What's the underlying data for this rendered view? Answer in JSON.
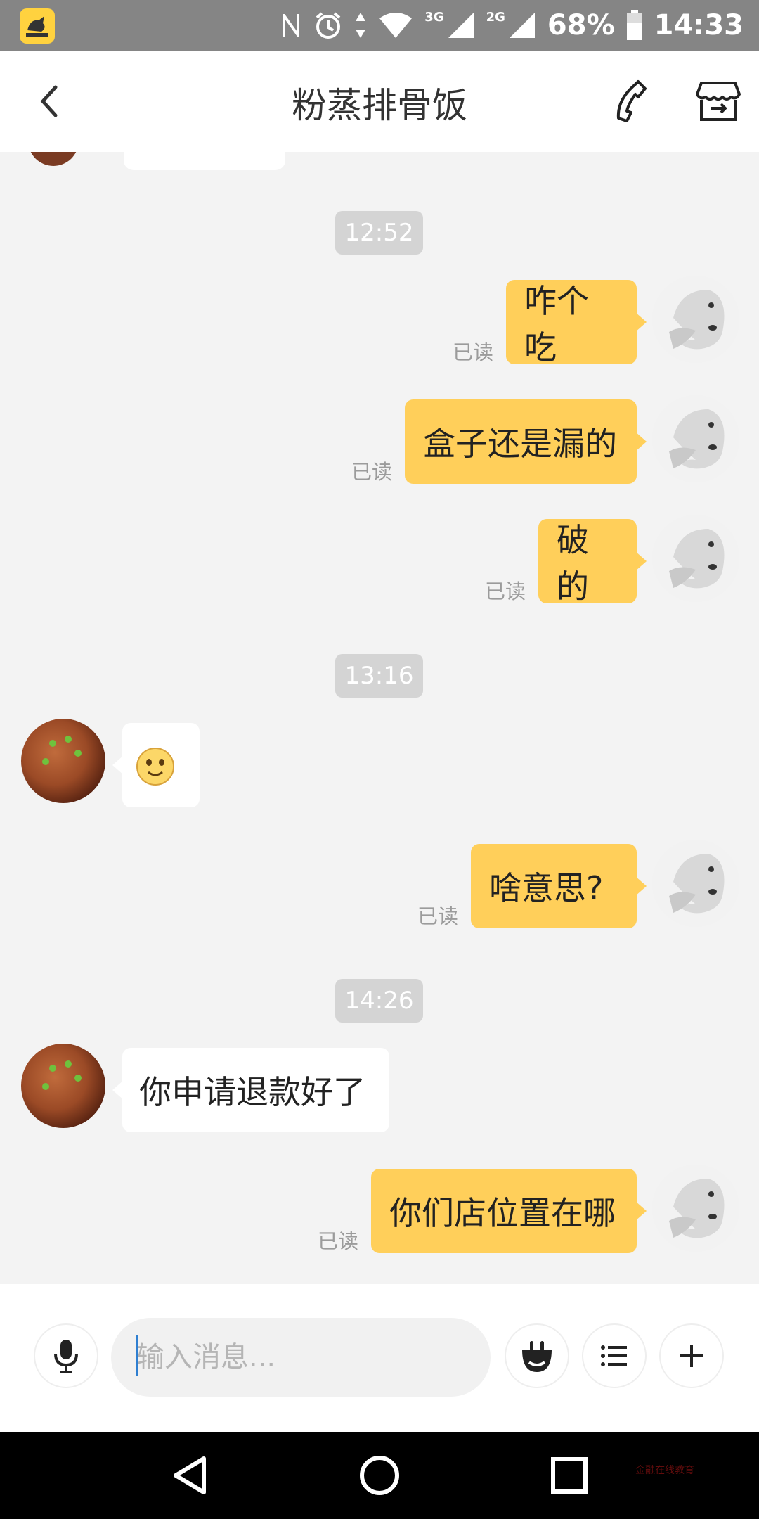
{
  "status_bar": {
    "battery": "68%",
    "time": "14:33",
    "network_3g": "3G",
    "network_2g": "2G",
    "icons": [
      "app-icon",
      "nfc-icon",
      "alarm-icon",
      "data-arrows-icon",
      "wifi-icon",
      "signal-icon",
      "signal-icon",
      "battery-icon"
    ]
  },
  "header": {
    "title": "粉蒸排骨饭",
    "back_icon": "chevron-left-icon",
    "phone_icon": "phone-icon",
    "shop_icon": "shop-icon"
  },
  "messages": {
    "t1": "12:52",
    "m1": "咋个吃",
    "m2": "盒子还是漏的",
    "m3": "破的",
    "t2": "13:16",
    "m4_emoji": "smile-emoji-icon",
    "m5": "啥意思?",
    "t3": "14:26",
    "m6": "你申请退款好了",
    "m7": "你们店位置在哪",
    "read_label": "已读"
  },
  "input_bar": {
    "placeholder": "输入消息...",
    "icons": [
      "microphone-icon",
      "emoji-icon",
      "list-icon",
      "plus-icon"
    ]
  },
  "nav_bar": {
    "watermark": "金融在线教育"
  },
  "colors": {
    "outgoing_bubble": "#ffcf5a",
    "incoming_bubble": "#ffffff",
    "chat_bg": "#f3f3f3",
    "status_bar": "#858585"
  }
}
